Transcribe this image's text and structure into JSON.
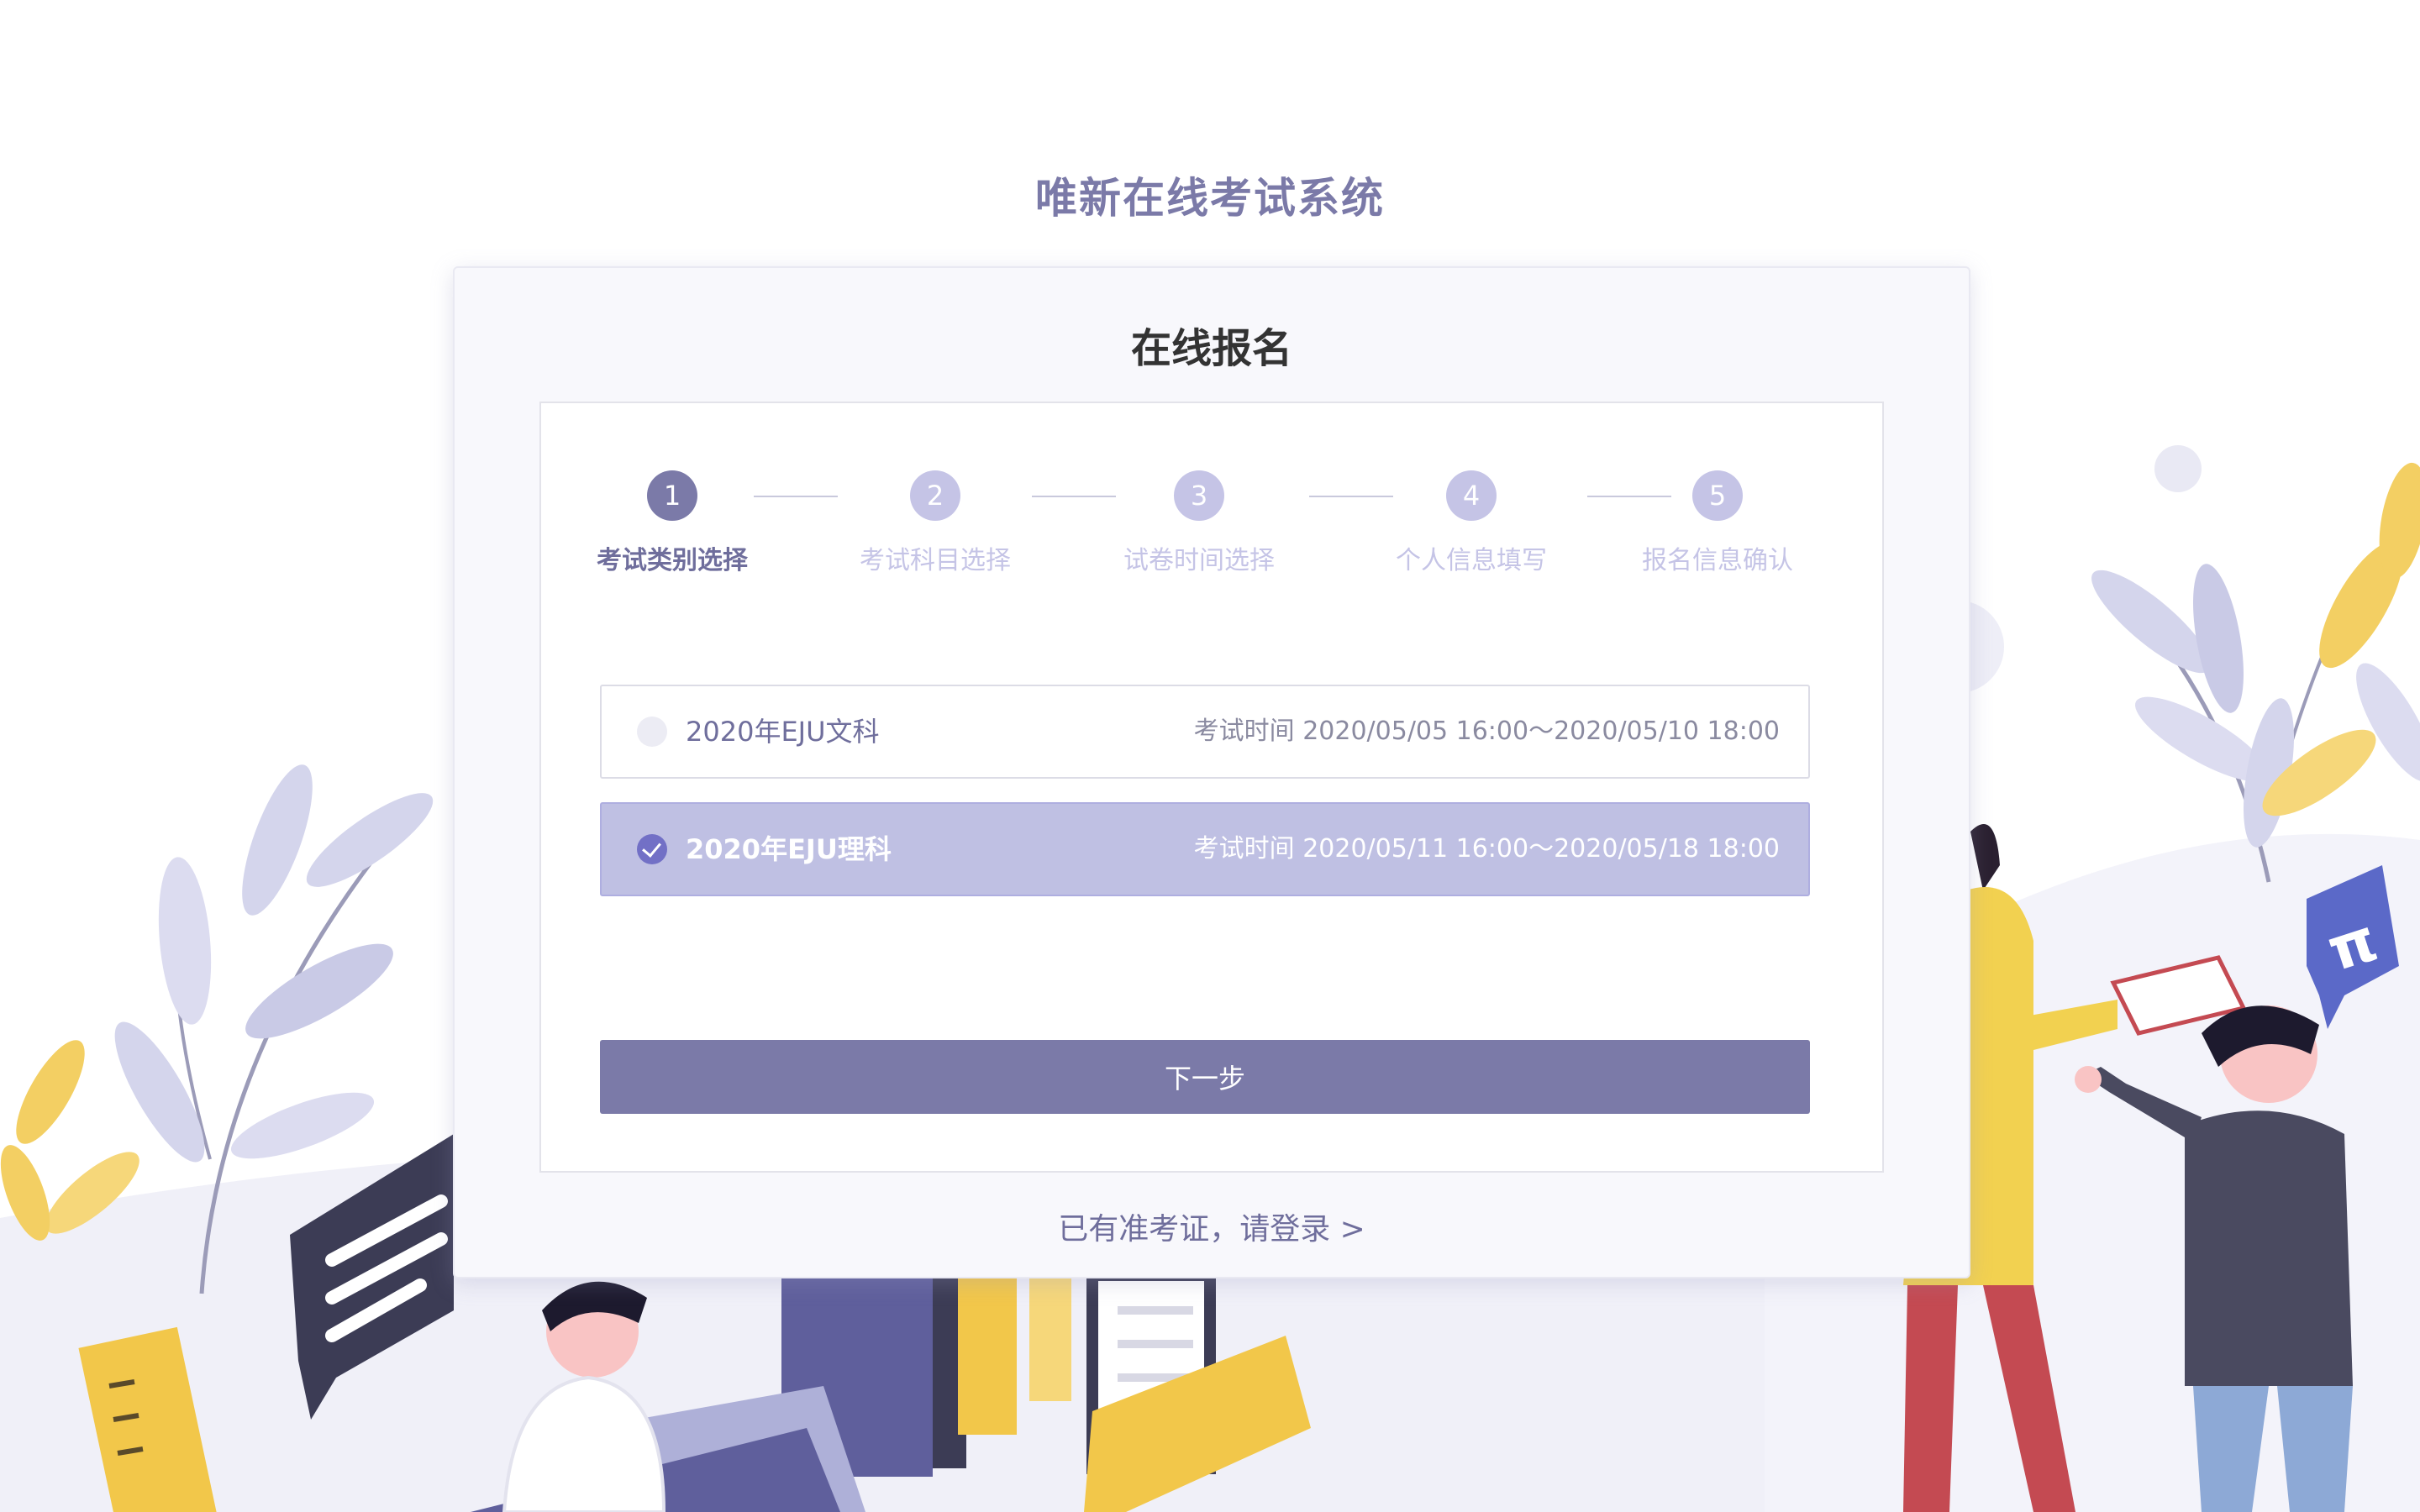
{
  "app": {
    "title": "唯新在线考试系统",
    "accent_color": "#7b7aa8",
    "light_accent_color": "#c5c4e6"
  },
  "card": {
    "title": "在线报名"
  },
  "steps": [
    {
      "number": "1",
      "label": "考试类别选择",
      "state": "active"
    },
    {
      "number": "2",
      "label": "考试科目选择",
      "state": "inactive"
    },
    {
      "number": "3",
      "label": "试卷时间选择",
      "state": "inactive"
    },
    {
      "number": "4",
      "label": "个人信息填写",
      "state": "inactive"
    },
    {
      "number": "5",
      "label": "报名信息确认",
      "state": "inactive"
    }
  ],
  "options": [
    {
      "name": "2020年EJU文科",
      "time": "考试时间 2020/05/05 16:00～2020/05/10 18:00",
      "selected": false
    },
    {
      "name": "2020年EJU理科",
      "time": "考试时间 2020/05/11 16:00～2020/05/18 18:00",
      "selected": true
    }
  ],
  "next_button": {
    "label": "下一步"
  },
  "login_link": {
    "label": "已有准考证，请登录 >"
  },
  "illustration": {
    "badge_symbol": "π"
  }
}
